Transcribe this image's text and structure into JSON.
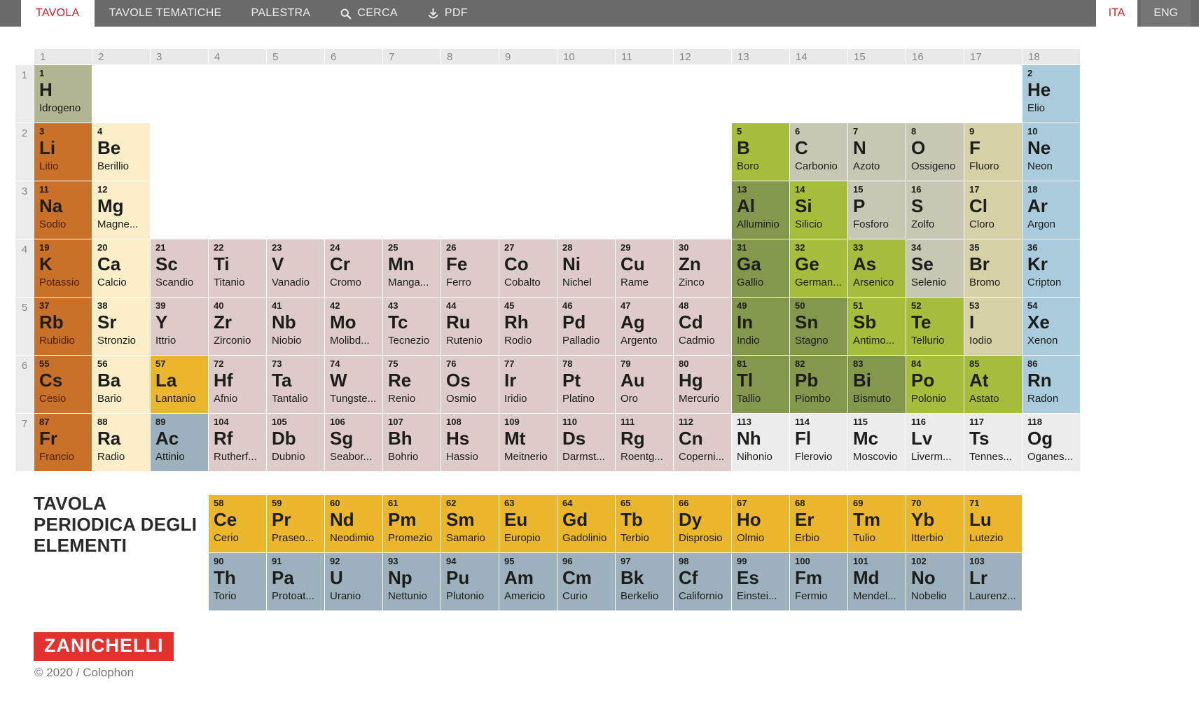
{
  "nav": {
    "tabs": [
      {
        "label": "TAVOLA",
        "active": true
      },
      {
        "label": "TAVOLE TEMATICHE",
        "active": false
      },
      {
        "label": "PALESTRA",
        "active": false
      }
    ],
    "search_label": "CERCA",
    "pdf_label": "PDF",
    "lang_tabs": [
      {
        "label": "ITA",
        "active": true
      },
      {
        "label": "ENG",
        "active": false
      }
    ]
  },
  "table": {
    "group_headers": [
      "1",
      "2",
      "3",
      "4",
      "5",
      "6",
      "7",
      "8",
      "9",
      "10",
      "11",
      "12",
      "13",
      "14",
      "15",
      "16",
      "17",
      "18"
    ],
    "period_headers": [
      "1",
      "2",
      "3",
      "4",
      "5",
      "6",
      "7"
    ]
  },
  "colors": {
    "hydrogen": "#b1b592",
    "nonmetal": "#c6c8b4",
    "halogen": "#d6d0a6",
    "noble": "#a9cbdc",
    "alkali": "#c97029",
    "alkaline": "#fceec8",
    "transition": "#ddcbca",
    "posttransition": "#83984d",
    "metalloid": "#a4be3c",
    "lanthanide": "#eab72c",
    "actinide": "#9cb1bc",
    "unknown": "#ececec"
  },
  "elements": [
    {
      "z": "1",
      "s": "H",
      "n": "Idrogeno",
      "g": 1,
      "p": 1,
      "c": "hydrogen"
    },
    {
      "z": "2",
      "s": "He",
      "n": "Elio",
      "g": 18,
      "p": 1,
      "c": "noble"
    },
    {
      "z": "3",
      "s": "Li",
      "n": "Litio",
      "g": 1,
      "p": 2,
      "c": "alkali"
    },
    {
      "z": "4",
      "s": "Be",
      "n": "Berillio",
      "g": 2,
      "p": 2,
      "c": "alkaline"
    },
    {
      "z": "5",
      "s": "B",
      "n": "Boro",
      "g": 13,
      "p": 2,
      "c": "metalloid"
    },
    {
      "z": "6",
      "s": "C",
      "n": "Carbonio",
      "g": 14,
      "p": 2,
      "c": "nonmetal"
    },
    {
      "z": "7",
      "s": "N",
      "n": "Azoto",
      "g": 15,
      "p": 2,
      "c": "nonmetal"
    },
    {
      "z": "8",
      "s": "O",
      "n": "Ossigeno",
      "g": 16,
      "p": 2,
      "c": "nonmetal"
    },
    {
      "z": "9",
      "s": "F",
      "n": "Fluoro",
      "g": 17,
      "p": 2,
      "c": "halogen"
    },
    {
      "z": "10",
      "s": "Ne",
      "n": "Neon",
      "g": 18,
      "p": 2,
      "c": "noble"
    },
    {
      "z": "11",
      "s": "Na",
      "n": "Sodio",
      "g": 1,
      "p": 3,
      "c": "alkali"
    },
    {
      "z": "12",
      "s": "Mg",
      "n": "Magne...",
      "g": 2,
      "p": 3,
      "c": "alkaline"
    },
    {
      "z": "13",
      "s": "Al",
      "n": "Alluminio",
      "g": 13,
      "p": 3,
      "c": "posttransition"
    },
    {
      "z": "14",
      "s": "Si",
      "n": "Silicio",
      "g": 14,
      "p": 3,
      "c": "metalloid"
    },
    {
      "z": "15",
      "s": "P",
      "n": "Fosforo",
      "g": 15,
      "p": 3,
      "c": "nonmetal"
    },
    {
      "z": "16",
      "s": "S",
      "n": "Zolfo",
      "g": 16,
      "p": 3,
      "c": "nonmetal"
    },
    {
      "z": "17",
      "s": "Cl",
      "n": "Cloro",
      "g": 17,
      "p": 3,
      "c": "halogen"
    },
    {
      "z": "18",
      "s": "Ar",
      "n": "Argon",
      "g": 18,
      "p": 3,
      "c": "noble"
    },
    {
      "z": "19",
      "s": "K",
      "n": "Potassio",
      "g": 1,
      "p": 4,
      "c": "alkali"
    },
    {
      "z": "20",
      "s": "Ca",
      "n": "Calcio",
      "g": 2,
      "p": 4,
      "c": "alkaline"
    },
    {
      "z": "21",
      "s": "Sc",
      "n": "Scandio",
      "g": 3,
      "p": 4,
      "c": "transition"
    },
    {
      "z": "22",
      "s": "Ti",
      "n": "Titanio",
      "g": 4,
      "p": 4,
      "c": "transition"
    },
    {
      "z": "23",
      "s": "V",
      "n": "Vanadio",
      "g": 5,
      "p": 4,
      "c": "transition"
    },
    {
      "z": "24",
      "s": "Cr",
      "n": "Cromo",
      "g": 6,
      "p": 4,
      "c": "transition"
    },
    {
      "z": "25",
      "s": "Mn",
      "n": "Manga...",
      "g": 7,
      "p": 4,
      "c": "transition"
    },
    {
      "z": "26",
      "s": "Fe",
      "n": "Ferro",
      "g": 8,
      "p": 4,
      "c": "transition"
    },
    {
      "z": "27",
      "s": "Co",
      "n": "Cobalto",
      "g": 9,
      "p": 4,
      "c": "transition"
    },
    {
      "z": "28",
      "s": "Ni",
      "n": "Nichel",
      "g": 10,
      "p": 4,
      "c": "transition"
    },
    {
      "z": "29",
      "s": "Cu",
      "n": "Rame",
      "g": 11,
      "p": 4,
      "c": "transition"
    },
    {
      "z": "30",
      "s": "Zn",
      "n": "Zinco",
      "g": 12,
      "p": 4,
      "c": "transition"
    },
    {
      "z": "31",
      "s": "Ga",
      "n": "Gallio",
      "g": 13,
      "p": 4,
      "c": "posttransition"
    },
    {
      "z": "32",
      "s": "Ge",
      "n": "German...",
      "g": 14,
      "p": 4,
      "c": "metalloid"
    },
    {
      "z": "33",
      "s": "As",
      "n": "Arsenico",
      "g": 15,
      "p": 4,
      "c": "metalloid"
    },
    {
      "z": "34",
      "s": "Se",
      "n": "Selenio",
      "g": 16,
      "p": 4,
      "c": "nonmetal"
    },
    {
      "z": "35",
      "s": "Br",
      "n": "Bromo",
      "g": 17,
      "p": 4,
      "c": "halogen"
    },
    {
      "z": "36",
      "s": "Kr",
      "n": "Cripton",
      "g": 18,
      "p": 4,
      "c": "noble"
    },
    {
      "z": "37",
      "s": "Rb",
      "n": "Rubidio",
      "g": 1,
      "p": 5,
      "c": "alkali"
    },
    {
      "z": "38",
      "s": "Sr",
      "n": "Stronzio",
      "g": 2,
      "p": 5,
      "c": "alkaline"
    },
    {
      "z": "39",
      "s": "Y",
      "n": "Ittrio",
      "g": 3,
      "p": 5,
      "c": "transition"
    },
    {
      "z": "40",
      "s": "Zr",
      "n": "Zirconio",
      "g": 4,
      "p": 5,
      "c": "transition"
    },
    {
      "z": "41",
      "s": "Nb",
      "n": "Niobio",
      "g": 5,
      "p": 5,
      "c": "transition"
    },
    {
      "z": "42",
      "s": "Mo",
      "n": "Molibd...",
      "g": 6,
      "p": 5,
      "c": "transition"
    },
    {
      "z": "43",
      "s": "Tc",
      "n": "Tecnezio",
      "g": 7,
      "p": 5,
      "c": "transition"
    },
    {
      "z": "44",
      "s": "Ru",
      "n": "Rutenio",
      "g": 8,
      "p": 5,
      "c": "transition"
    },
    {
      "z": "45",
      "s": "Rh",
      "n": "Rodio",
      "g": 9,
      "p": 5,
      "c": "transition"
    },
    {
      "z": "46",
      "s": "Pd",
      "n": "Palladio",
      "g": 10,
      "p": 5,
      "c": "transition"
    },
    {
      "z": "47",
      "s": "Ag",
      "n": "Argento",
      "g": 11,
      "p": 5,
      "c": "transition"
    },
    {
      "z": "48",
      "s": "Cd",
      "n": "Cadmio",
      "g": 12,
      "p": 5,
      "c": "transition"
    },
    {
      "z": "49",
      "s": "In",
      "n": "Indio",
      "g": 13,
      "p": 5,
      "c": "posttransition"
    },
    {
      "z": "50",
      "s": "Sn",
      "n": "Stagno",
      "g": 14,
      "p": 5,
      "c": "posttransition"
    },
    {
      "z": "51",
      "s": "Sb",
      "n": "Antimo...",
      "g": 15,
      "p": 5,
      "c": "metalloid"
    },
    {
      "z": "52",
      "s": "Te",
      "n": "Tellurio",
      "g": 16,
      "p": 5,
      "c": "metalloid"
    },
    {
      "z": "53",
      "s": "I",
      "n": "Iodio",
      "g": 17,
      "p": 5,
      "c": "halogen"
    },
    {
      "z": "54",
      "s": "Xe",
      "n": "Xenon",
      "g": 18,
      "p": 5,
      "c": "noble"
    },
    {
      "z": "55",
      "s": "Cs",
      "n": "Cesio",
      "g": 1,
      "p": 6,
      "c": "alkali"
    },
    {
      "z": "56",
      "s": "Ba",
      "n": "Bario",
      "g": 2,
      "p": 6,
      "c": "alkaline"
    },
    {
      "z": "57",
      "s": "La",
      "n": "Lantanio",
      "g": 3,
      "p": 6,
      "c": "lanthanide"
    },
    {
      "z": "72",
      "s": "Hf",
      "n": "Afnio",
      "g": 4,
      "p": 6,
      "c": "transition"
    },
    {
      "z": "73",
      "s": "Ta",
      "n": "Tantalio",
      "g": 5,
      "p": 6,
      "c": "transition"
    },
    {
      "z": "74",
      "s": "W",
      "n": "Tungste...",
      "g": 6,
      "p": 6,
      "c": "transition"
    },
    {
      "z": "75",
      "s": "Re",
      "n": "Renio",
      "g": 7,
      "p": 6,
      "c": "transition"
    },
    {
      "z": "76",
      "s": "Os",
      "n": "Osmio",
      "g": 8,
      "p": 6,
      "c": "transition"
    },
    {
      "z": "77",
      "s": "Ir",
      "n": "Iridio",
      "g": 9,
      "p": 6,
      "c": "transition"
    },
    {
      "z": "78",
      "s": "Pt",
      "n": "Platino",
      "g": 10,
      "p": 6,
      "c": "transition"
    },
    {
      "z": "79",
      "s": "Au",
      "n": "Oro",
      "g": 11,
      "p": 6,
      "c": "transition"
    },
    {
      "z": "80",
      "s": "Hg",
      "n": "Mercurio",
      "g": 12,
      "p": 6,
      "c": "transition"
    },
    {
      "z": "81",
      "s": "Tl",
      "n": "Tallio",
      "g": 13,
      "p": 6,
      "c": "posttransition"
    },
    {
      "z": "82",
      "s": "Pb",
      "n": "Piombo",
      "g": 14,
      "p": 6,
      "c": "posttransition"
    },
    {
      "z": "83",
      "s": "Bi",
      "n": "Bismuto",
      "g": 15,
      "p": 6,
      "c": "posttransition"
    },
    {
      "z": "84",
      "s": "Po",
      "n": "Polonio",
      "g": 16,
      "p": 6,
      "c": "metalloid"
    },
    {
      "z": "85",
      "s": "At",
      "n": "Astato",
      "g": 17,
      "p": 6,
      "c": "metalloid"
    },
    {
      "z": "86",
      "s": "Rn",
      "n": "Radon",
      "g": 18,
      "p": 6,
      "c": "noble"
    },
    {
      "z": "87",
      "s": "Fr",
      "n": "Francio",
      "g": 1,
      "p": 7,
      "c": "alkali"
    },
    {
      "z": "88",
      "s": "Ra",
      "n": "Radio",
      "g": 2,
      "p": 7,
      "c": "alkaline"
    },
    {
      "z": "89",
      "s": "Ac",
      "n": "Attinio",
      "g": 3,
      "p": 7,
      "c": "actinide"
    },
    {
      "z": "104",
      "s": "Rf",
      "n": "Rutherf...",
      "g": 4,
      "p": 7,
      "c": "transition"
    },
    {
      "z": "105",
      "s": "Db",
      "n": "Dubnio",
      "g": 5,
      "p": 7,
      "c": "transition"
    },
    {
      "z": "106",
      "s": "Sg",
      "n": "Seabor...",
      "g": 6,
      "p": 7,
      "c": "transition"
    },
    {
      "z": "107",
      "s": "Bh",
      "n": "Bohrio",
      "g": 7,
      "p": 7,
      "c": "transition"
    },
    {
      "z": "108",
      "s": "Hs",
      "n": "Hassio",
      "g": 8,
      "p": 7,
      "c": "transition"
    },
    {
      "z": "109",
      "s": "Mt",
      "n": "Meitnerio",
      "g": 9,
      "p": 7,
      "c": "transition"
    },
    {
      "z": "110",
      "s": "Ds",
      "n": "Darmst...",
      "g": 10,
      "p": 7,
      "c": "transition"
    },
    {
      "z": "111",
      "s": "Rg",
      "n": "Roentg...",
      "g": 11,
      "p": 7,
      "c": "transition"
    },
    {
      "z": "112",
      "s": "Cn",
      "n": "Coperni...",
      "g": 12,
      "p": 7,
      "c": "transition"
    },
    {
      "z": "113",
      "s": "Nh",
      "n": "Nihonio",
      "g": 13,
      "p": 7,
      "c": "unknown"
    },
    {
      "z": "114",
      "s": "Fl",
      "n": "Flerovio",
      "g": 14,
      "p": 7,
      "c": "unknown"
    },
    {
      "z": "115",
      "s": "Mc",
      "n": "Moscovio",
      "g": 15,
      "p": 7,
      "c": "unknown"
    },
    {
      "z": "116",
      "s": "Lv",
      "n": "Liverm...",
      "g": 16,
      "p": 7,
      "c": "unknown"
    },
    {
      "z": "117",
      "s": "Ts",
      "n": "Tennes...",
      "g": 17,
      "p": 7,
      "c": "unknown"
    },
    {
      "z": "118",
      "s": "Og",
      "n": "Oganes...",
      "g": 18,
      "p": 7,
      "c": "unknown"
    }
  ],
  "fblock": {
    "lanthanides": [
      {
        "z": "58",
        "s": "Ce",
        "n": "Cerio",
        "c": "lanthanide"
      },
      {
        "z": "59",
        "s": "Pr",
        "n": "Praseo...",
        "c": "lanthanide"
      },
      {
        "z": "60",
        "s": "Nd",
        "n": "Neodimio",
        "c": "lanthanide"
      },
      {
        "z": "61",
        "s": "Pm",
        "n": "Promezio",
        "c": "lanthanide"
      },
      {
        "z": "62",
        "s": "Sm",
        "n": "Samario",
        "c": "lanthanide"
      },
      {
        "z": "63",
        "s": "Eu",
        "n": "Europio",
        "c": "lanthanide"
      },
      {
        "z": "64",
        "s": "Gd",
        "n": "Gadolinio",
        "c": "lanthanide"
      },
      {
        "z": "65",
        "s": "Tb",
        "n": "Terbio",
        "c": "lanthanide"
      },
      {
        "z": "66",
        "s": "Dy",
        "n": "Disprosio",
        "c": "lanthanide"
      },
      {
        "z": "67",
        "s": "Ho",
        "n": "Olmio",
        "c": "lanthanide"
      },
      {
        "z": "68",
        "s": "Er",
        "n": "Erbio",
        "c": "lanthanide"
      },
      {
        "z": "69",
        "s": "Tm",
        "n": "Tulio",
        "c": "lanthanide"
      },
      {
        "z": "70",
        "s": "Yb",
        "n": "Itterbio",
        "c": "lanthanide"
      },
      {
        "z": "71",
        "s": "Lu",
        "n": "Lutezio",
        "c": "lanthanide"
      }
    ],
    "actinides": [
      {
        "z": "90",
        "s": "Th",
        "n": "Torio",
        "c": "actinide"
      },
      {
        "z": "91",
        "s": "Pa",
        "n": "Protoat...",
        "c": "actinide"
      },
      {
        "z": "92",
        "s": "U",
        "n": "Uranio",
        "c": "actinide"
      },
      {
        "z": "93",
        "s": "Np",
        "n": "Nettunio",
        "c": "actinide"
      },
      {
        "z": "94",
        "s": "Pu",
        "n": "Plutonio",
        "c": "actinide"
      },
      {
        "z": "95",
        "s": "Am",
        "n": "Americio",
        "c": "actinide"
      },
      {
        "z": "96",
        "s": "Cm",
        "n": "Curio",
        "c": "actinide"
      },
      {
        "z": "97",
        "s": "Bk",
        "n": "Berkelio",
        "c": "actinide"
      },
      {
        "z": "98",
        "s": "Cf",
        "n": "Californio",
        "c": "actinide"
      },
      {
        "z": "99",
        "s": "Es",
        "n": "Einstei...",
        "c": "actinide"
      },
      {
        "z": "100",
        "s": "Fm",
        "n": "Fermio",
        "c": "actinide"
      },
      {
        "z": "101",
        "s": "Md",
        "n": "Mendel...",
        "c": "actinide"
      },
      {
        "z": "102",
        "s": "No",
        "n": "Nobelio",
        "c": "actinide"
      },
      {
        "z": "103",
        "s": "Lr",
        "n": "Laurenz...",
        "c": "actinide"
      }
    ]
  },
  "footer": {
    "title": "TAVOLA\nPERIODICA DEGLI\nELEMENTI",
    "logo": "ZANICHELLI",
    "copyright": "© 2020 / Colophon"
  }
}
